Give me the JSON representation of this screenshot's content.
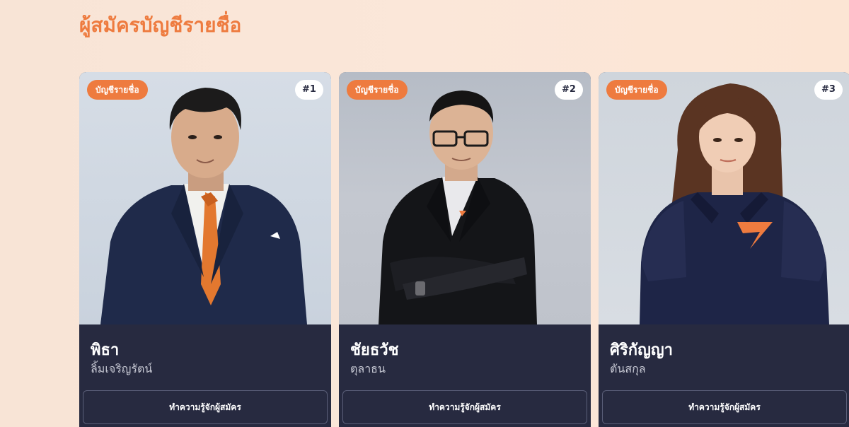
{
  "section": {
    "title": "ผู้สมัครบัญชีรายชื่อ"
  },
  "candidates": [
    {
      "badge": "บัญชีรายชื่อ",
      "number": "#1",
      "first_name": "พิธา",
      "last_name": "ลิ้มเจริญรัตน์",
      "button_label": "ทำความรู้จักผู้สมัคร"
    },
    {
      "badge": "บัญชีรายชื่อ",
      "number": "#2",
      "first_name": "ชัยธวัช",
      "last_name": "ตุลาธน",
      "button_label": "ทำความรู้จักผู้สมัคร"
    },
    {
      "badge": "บัญชีรายชื่อ",
      "number": "#3",
      "first_name": "ศิริกัญญา",
      "last_name": "ตันสกุล",
      "button_label": "ทำความรู้จักผู้สมัคร"
    }
  ],
  "colors": {
    "accent": "#ee7b3f",
    "card_background": "#272a40",
    "page_background": "#fbe7d9"
  }
}
